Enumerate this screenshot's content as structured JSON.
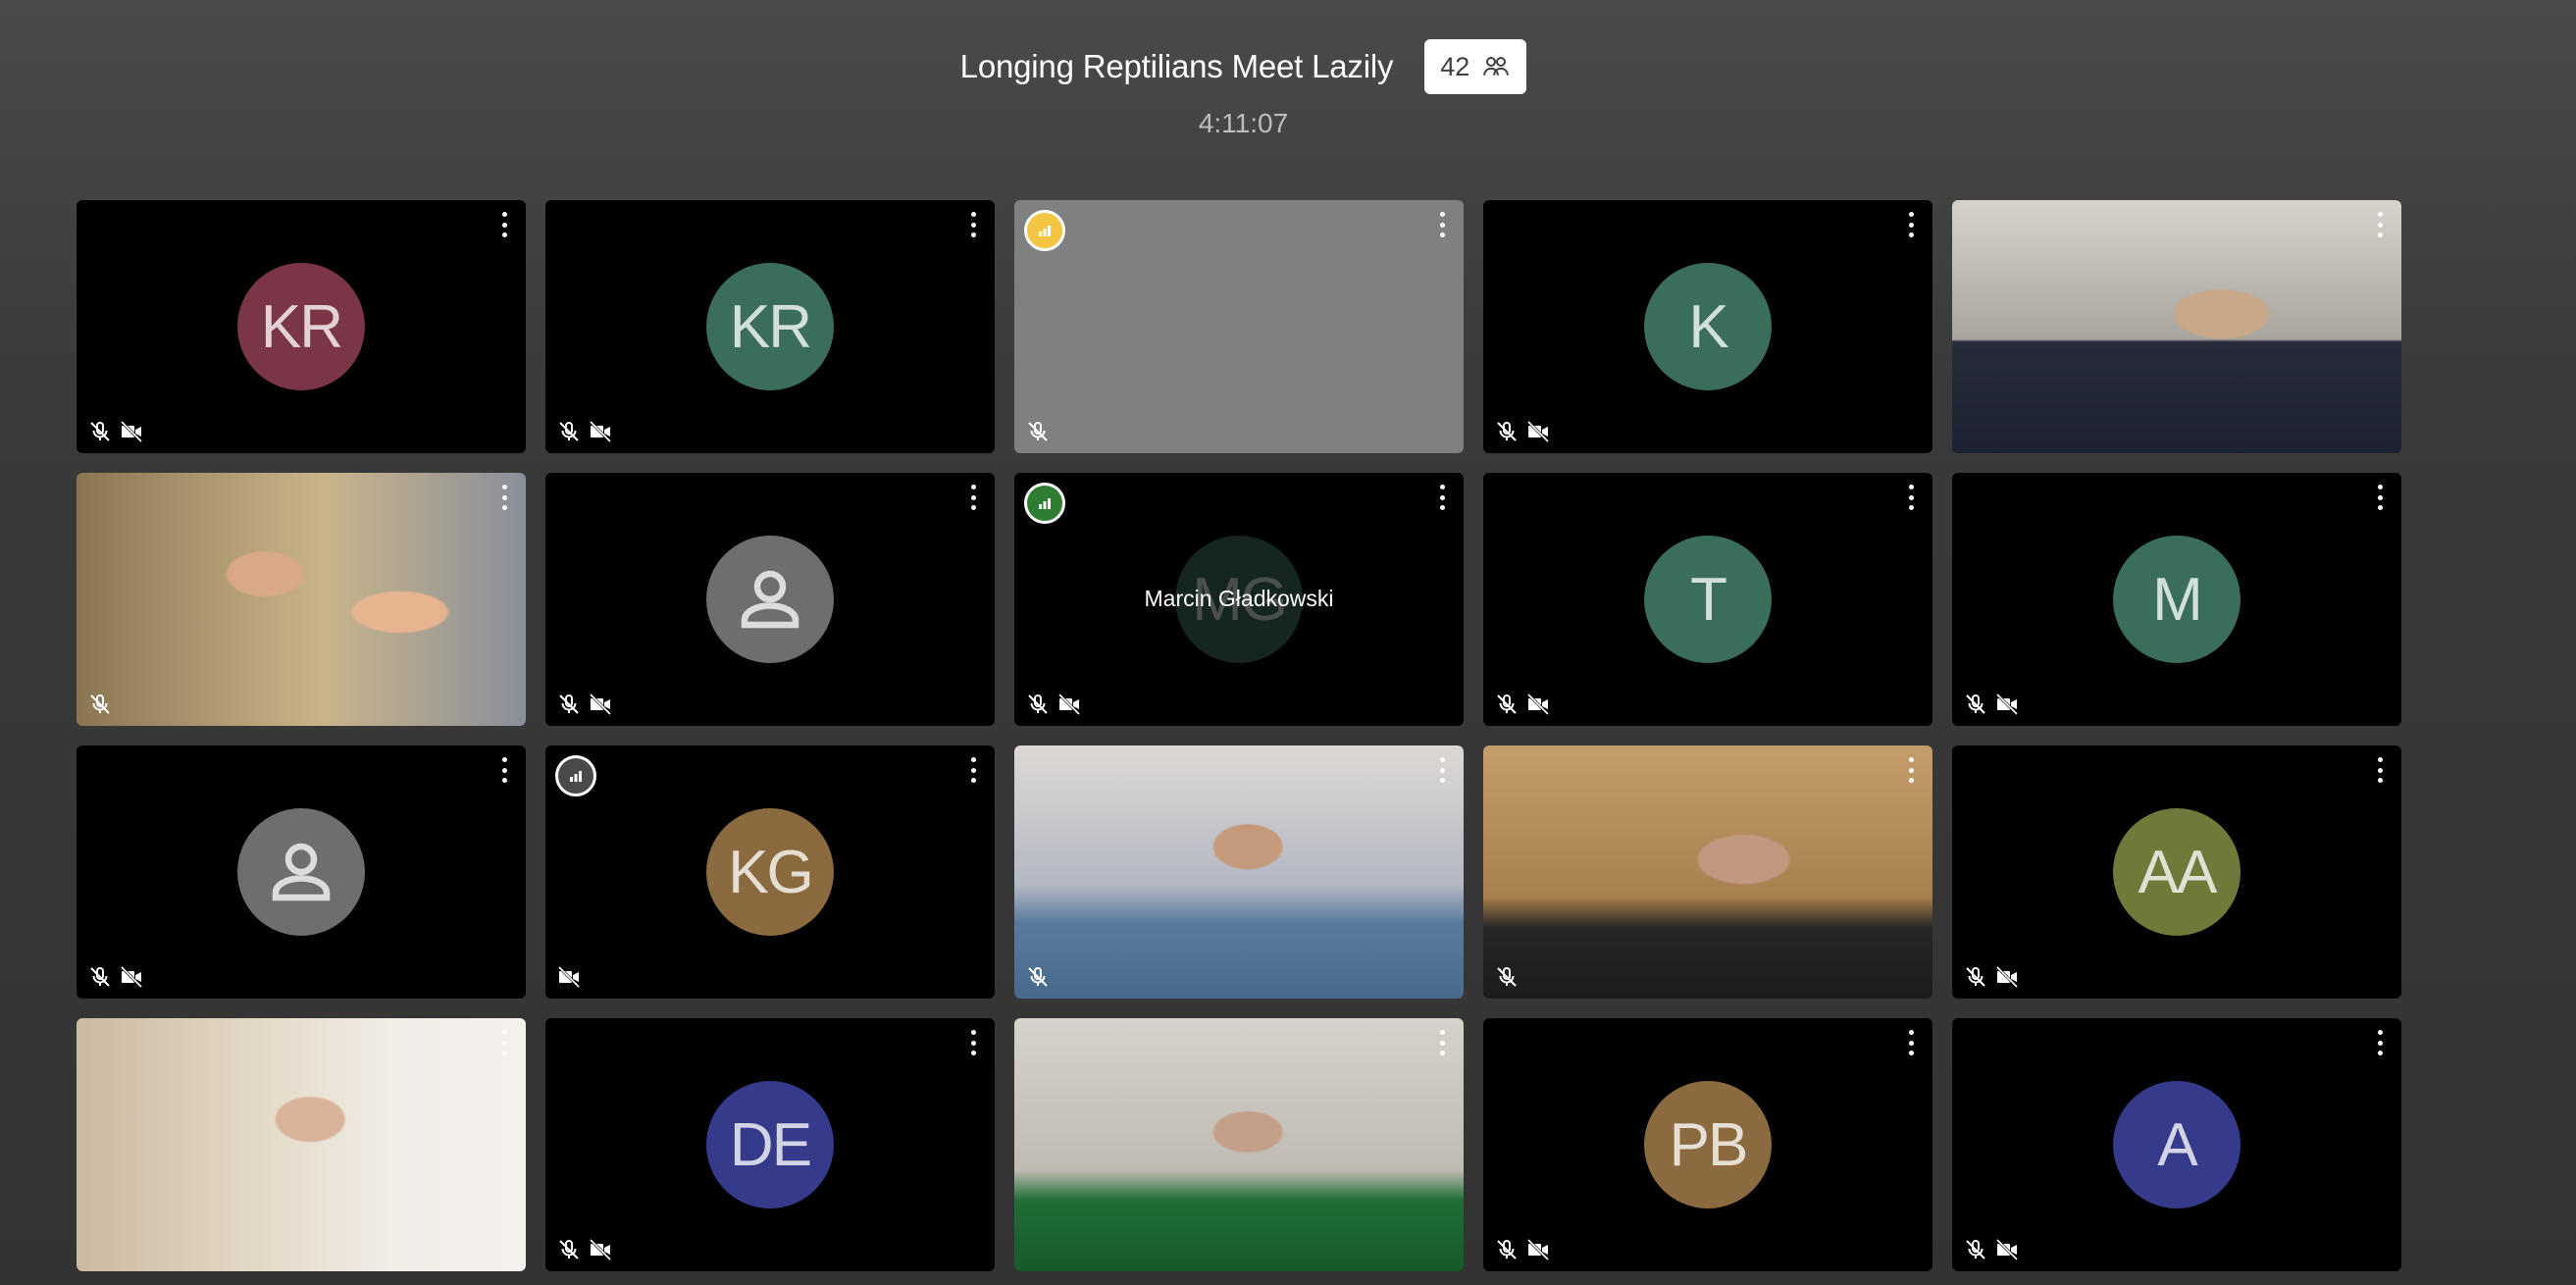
{
  "meeting": {
    "title": "Longing Reptilians Meet Lazily",
    "participant_count": "42",
    "timer": "4:11:07"
  },
  "colors": {
    "avatar_wine": "#7a3546",
    "avatar_green": "#3a6e5a",
    "avatar_brown": "#8a6a3e",
    "avatar_navy": "#353b8a",
    "avatar_olive": "#6f7a3a",
    "indicator_yellow": "#f4c542",
    "indicator_green": "#2e7d32",
    "indicator_dark": "#4a4a4a"
  },
  "tiles": [
    {
      "initials": "KR",
      "avatar_color": "#7a3546",
      "mic_off": true,
      "cam_off": true
    },
    {
      "initials": "KR",
      "avatar_color": "#3a6e5a",
      "mic_off": true,
      "cam_off": true
    },
    {
      "initials": "",
      "mic_off": true,
      "cam_off": false,
      "indicator": "yellow"
    },
    {
      "initials": "K",
      "avatar_color": "#3a6e5a",
      "mic_off": true,
      "cam_off": true
    },
    {
      "video": true
    },
    {
      "video": true,
      "mic_off": true
    },
    {
      "initials": "",
      "avatar_icon": "person-icon",
      "mic_off": true,
      "cam_off": true
    },
    {
      "initials": "MG",
      "avatar_color": "#3a6e5a",
      "name": "Marcin Gładkowski",
      "mic_off": true,
      "cam_off": true,
      "indicator": "green"
    },
    {
      "initials": "T",
      "avatar_color": "#3a6e5a",
      "mic_off": true,
      "cam_off": true
    },
    {
      "initials": "M",
      "avatar_color": "#3a6e5a",
      "mic_off": true,
      "cam_off": true
    },
    {
      "initials": "",
      "avatar_icon": "person-icon",
      "mic_off": true,
      "cam_off": true
    },
    {
      "initials": "KG",
      "avatar_color": "#8a6a3e",
      "cam_off": true,
      "indicator": "dark"
    },
    {
      "video": true,
      "mic_off": true
    },
    {
      "video": true,
      "mic_off": true
    },
    {
      "initials": "AA",
      "avatar_color": "#6f7a3a",
      "mic_off": true,
      "cam_off": true
    },
    {
      "video": true
    },
    {
      "initials": "DE",
      "avatar_color": "#353b8a",
      "mic_off": true,
      "cam_off": true
    },
    {
      "video": true
    },
    {
      "initials": "PB",
      "avatar_color": "#8a6a3e",
      "mic_off": true,
      "cam_off": true
    },
    {
      "initials": "A",
      "avatar_color": "#353b8a",
      "mic_off": true,
      "cam_off": true
    }
  ]
}
